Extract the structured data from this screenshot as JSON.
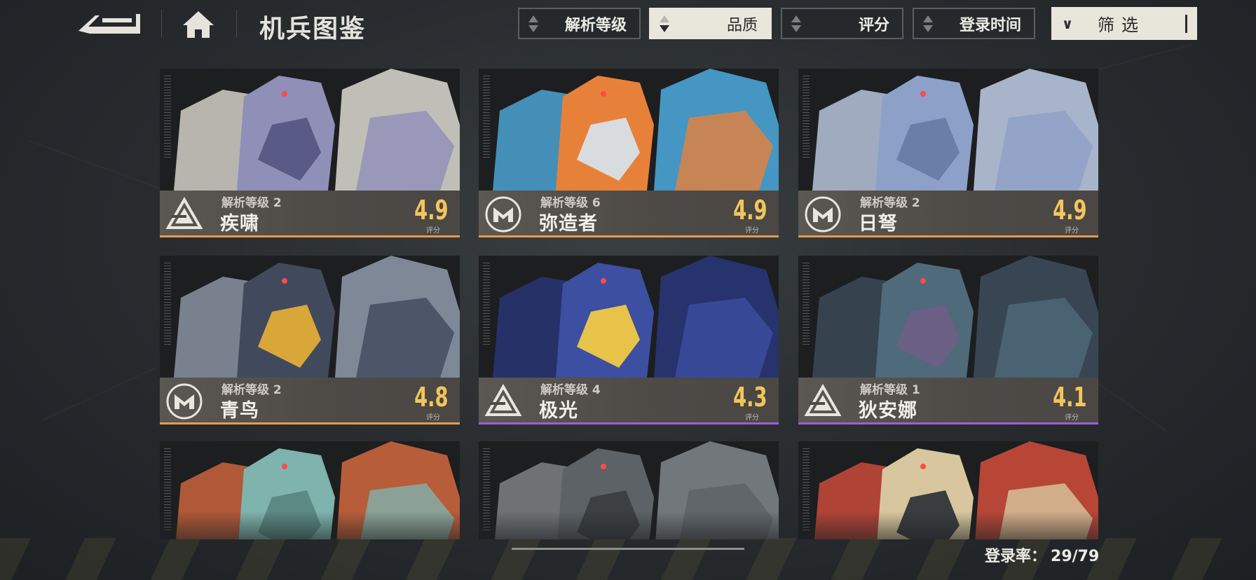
{
  "header": {
    "title": "机兵图鉴",
    "back_icon": "back-arrow-icon",
    "home_icon": "home-icon"
  },
  "sort_buttons": [
    {
      "label": "解析等级",
      "active": false
    },
    {
      "label": "品质",
      "active": true
    },
    {
      "label": "评分",
      "active": false
    },
    {
      "label": "登录时间",
      "active": false
    }
  ],
  "filter": {
    "label": "筛选",
    "icon": "chevron-down-icon"
  },
  "cards": [
    {
      "level": "解析等级 2",
      "name": "疾啸",
      "score": "4.9",
      "score_label": "评分",
      "emblem": "triangle-emblem-icon",
      "rarity_color": "#e79a4d",
      "art": [
        "#8f8fb8",
        "#5a5a86",
        "#d3d0c8"
      ]
    },
    {
      "level": "解析等级 6",
      "name": "弥造者",
      "score": "4.9",
      "score_label": "评分",
      "emblem": "m-shield-emblem-icon",
      "rarity_color": "#e79a4d",
      "art": [
        "#e7813a",
        "#d9dcdf",
        "#4aa3d4"
      ]
    },
    {
      "level": "解析等级 2",
      "name": "日弩",
      "score": "4.9",
      "score_label": "评分",
      "emblem": "m-shield-emblem-icon",
      "rarity_color": "#e79a4d",
      "art": [
        "#8da0c8",
        "#6b7ea7",
        "#b8c4dc"
      ]
    },
    {
      "level": "解析等级 2",
      "name": "青鸟",
      "score": "4.8",
      "score_label": "评分",
      "emblem": "m-shield-emblem-icon",
      "rarity_color": "#e79a4d",
      "art": [
        "#414a5c",
        "#d9a63a",
        "#8a93a3"
      ]
    },
    {
      "level": "解析等级 4",
      "name": "极光",
      "score": "4.3",
      "score_label": "评分",
      "emblem": "triangle-emblem-icon",
      "rarity_color": "#9c5fd6",
      "art": [
        "#3c4fa0",
        "#e7c34a",
        "#283575"
      ]
    },
    {
      "level": "解析等级 1",
      "name": "狄安娜",
      "score": "4.1",
      "score_label": "评分",
      "emblem": "triangle-emblem-icon",
      "rarity_color": "#9c5fd6",
      "art": [
        "#4f6a7a",
        "#6b5f86",
        "#3b4a58"
      ]
    }
  ],
  "partial_cards": [
    {
      "art": [
        "#7fb3ad",
        "#5b8983",
        "#c9643d"
      ]
    },
    {
      "art": [
        "#5d6266",
        "#3c4043",
        "#7c8185"
      ]
    },
    {
      "art": [
        "#d8c79e",
        "#3a3d40",
        "#c94a3a"
      ]
    }
  ],
  "footer": {
    "login_rate_label": "登录率：",
    "login_rate_value": "29/79"
  },
  "colors": {
    "accent_score": "#f3c55b",
    "rarity_orange": "#e79a4d",
    "rarity_purple": "#9c5fd6"
  }
}
